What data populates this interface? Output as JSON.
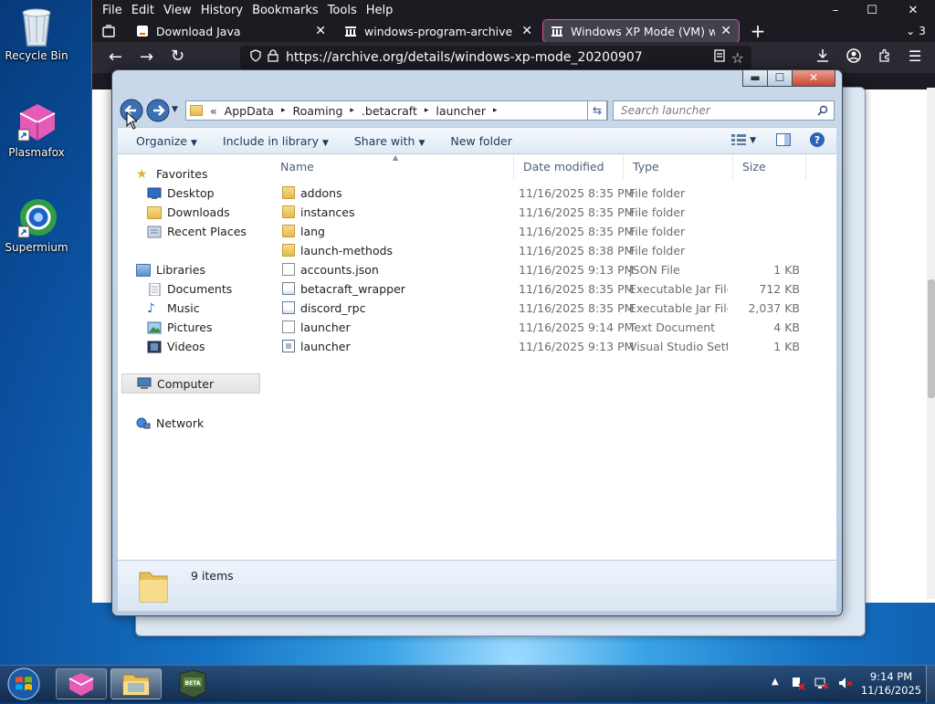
{
  "desktop": {
    "icons": [
      {
        "label": "Recycle Bin"
      },
      {
        "label": "Plasmafox"
      },
      {
        "label": "Supermium"
      }
    ]
  },
  "browser": {
    "menu": [
      "File",
      "Edit",
      "View",
      "History",
      "Bookmarks",
      "Tools",
      "Help"
    ],
    "tabs": [
      {
        "title": "Download Java"
      },
      {
        "title": "windows-program-archive directory"
      },
      {
        "title": "Windows XP Mode (VM) with Windows"
      }
    ],
    "tab_overflow_count": "3",
    "url": "https://archive.org/details/windows-xp-mode_20200907",
    "window_controls": {
      "minimize": "–",
      "maximize": "☐",
      "close": "✕"
    }
  },
  "explorer": {
    "breadcrumb": [
      "«",
      "AppData",
      "Roaming",
      ".betacraft",
      "launcher"
    ],
    "search_placeholder": "Search launcher",
    "commands": {
      "organize": "Organize",
      "include_in_library": "Include in library",
      "share_with": "Share with",
      "new_folder": "New folder"
    },
    "nav": {
      "favorites": "Favorites",
      "favorites_items": [
        "Desktop",
        "Downloads",
        "Recent Places"
      ],
      "libraries": "Libraries",
      "libraries_items": [
        "Documents",
        "Music",
        "Pictures",
        "Videos"
      ],
      "computer": "Computer",
      "network": "Network"
    },
    "columns": {
      "name": "Name",
      "date": "Date modified",
      "type": "Type",
      "size": "Size"
    },
    "files": [
      {
        "name": "addons",
        "date": "11/16/2025 8:35 PM",
        "type": "File folder",
        "size": "",
        "icon": "folder-icon"
      },
      {
        "name": "instances",
        "date": "11/16/2025 8:35 PM",
        "type": "File folder",
        "size": "",
        "icon": "folder-icon"
      },
      {
        "name": "lang",
        "date": "11/16/2025 8:35 PM",
        "type": "File folder",
        "size": "",
        "icon": "folder-icon"
      },
      {
        "name": "launch-methods",
        "date": "11/16/2025 8:38 PM",
        "type": "File folder",
        "size": "",
        "icon": "folder-icon"
      },
      {
        "name": "accounts.json",
        "date": "11/16/2025 9:13 PM",
        "type": "JSON File",
        "size": "1 KB",
        "icon": "file-icon"
      },
      {
        "name": "betacraft_wrapper",
        "date": "11/16/2025 8:35 PM",
        "type": "Executable Jar File",
        "size": "712 KB",
        "icon": "jar-icon"
      },
      {
        "name": "discord_rpc",
        "date": "11/16/2025 8:35 PM",
        "type": "Executable Jar File",
        "size": "2,037 KB",
        "icon": "jar-icon"
      },
      {
        "name": "launcher",
        "date": "11/16/2025 9:14 PM",
        "type": "Text Document",
        "size": "4 KB",
        "icon": "text-file-icon"
      },
      {
        "name": "launcher",
        "date": "11/16/2025 9:13 PM",
        "type": "Visual Studio Setti...",
        "size": "1 KB",
        "icon": "settings-file-icon"
      }
    ],
    "status": "9 items"
  },
  "taskbar": {
    "time": "9:14 PM",
    "date": "11/16/2025"
  }
}
